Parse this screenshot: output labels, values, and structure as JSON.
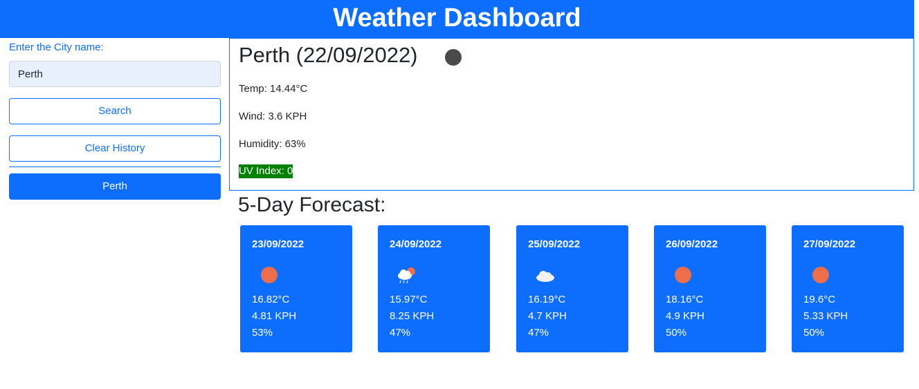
{
  "header": {
    "title": "Weather Dashboard"
  },
  "sidebar": {
    "label": "Enter the City name:",
    "input_value": "Perth",
    "search_label": "Search",
    "clear_label": "Clear History",
    "history": [
      "Perth"
    ]
  },
  "current": {
    "title": "Perth (22/09/2022)",
    "icon": "dark-circle-icon",
    "temp": "Temp: 14.44°C",
    "wind": "Wind: 3.6 KPH",
    "humidity": "Humidity: 63%",
    "uv": "UV Index: 0",
    "uv_color": "#008000"
  },
  "forecast": {
    "title": "5-Day Forecast:",
    "days": [
      {
        "date": "23/09/2022",
        "icon": "sun-icon",
        "temp": "16.82°C",
        "wind": "4.81 KPH",
        "humidity": "53%"
      },
      {
        "date": "24/09/2022",
        "icon": "rain-sun-cloud-icon",
        "temp": "15.97°C",
        "wind": "8.25 KPH",
        "humidity": "47%"
      },
      {
        "date": "25/09/2022",
        "icon": "cloud-icon",
        "temp": "16.19°C",
        "wind": "4.7 KPH",
        "humidity": "47%"
      },
      {
        "date": "26/09/2022",
        "icon": "sun-icon",
        "temp": "18.16°C",
        "wind": "4.9 KPH",
        "humidity": "50%"
      },
      {
        "date": "27/09/2022",
        "icon": "sun-icon",
        "temp": "19.6°C",
        "wind": "5.33 KPH",
        "humidity": "50%"
      }
    ]
  },
  "colors": {
    "accent": "#0d6efd",
    "sun": "#ec6e4c",
    "uv": "#008000"
  }
}
